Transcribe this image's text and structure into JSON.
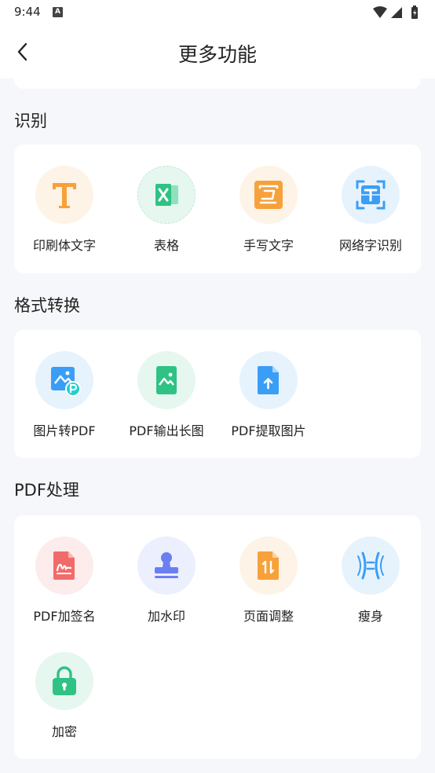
{
  "status": {
    "time": "9:44",
    "notif_letter": "A"
  },
  "header": {
    "title": "更多功能"
  },
  "sections": [
    {
      "title": "识别",
      "items": [
        {
          "label": "印刷体文字",
          "icon": "print-text-icon",
          "bg": "#fdf3e6",
          "color": "#f7a13a"
        },
        {
          "label": "表格",
          "icon": "excel-table-icon",
          "bg": "#e6f7f0",
          "color": "#2fc285"
        },
        {
          "label": "手写文字",
          "icon": "handwriting-icon",
          "bg": "#fdf3e6",
          "color": "#f7a13a"
        },
        {
          "label": "网络字识别",
          "icon": "scan-text-icon",
          "bg": "#e6f3fd",
          "color": "#3a9ef7"
        }
      ]
    },
    {
      "title": "格式转换",
      "items": [
        {
          "label": "图片转PDF",
          "icon": "image-to-pdf-icon",
          "bg": "#e6f3fd",
          "color": "#3a9ef7"
        },
        {
          "label": "PDF输出长图",
          "icon": "pdf-long-image-icon",
          "bg": "#e6f7f0",
          "color": "#2fc285"
        },
        {
          "label": "PDF提取图片",
          "icon": "pdf-extract-image-icon",
          "bg": "#e6f3fd",
          "color": "#3a9ef7"
        }
      ]
    },
    {
      "title": "PDF处理",
      "items": [
        {
          "label": "PDF加签名",
          "icon": "pdf-signature-icon",
          "bg": "#fdecec",
          "color": "#f26b6b"
        },
        {
          "label": "加水印",
          "icon": "watermark-stamp-icon",
          "bg": "#eceffd",
          "color": "#6b7ff2"
        },
        {
          "label": "页面调整",
          "icon": "page-adjust-icon",
          "bg": "#fdf3e6",
          "color": "#f7a13a"
        },
        {
          "label": "瘦身",
          "icon": "compress-icon",
          "bg": "#e6f3fd",
          "color": "#3a9ef7"
        },
        {
          "label": "加密",
          "icon": "lock-icon",
          "bg": "#e6f7f0",
          "color": "#2fc285"
        }
      ]
    }
  ]
}
